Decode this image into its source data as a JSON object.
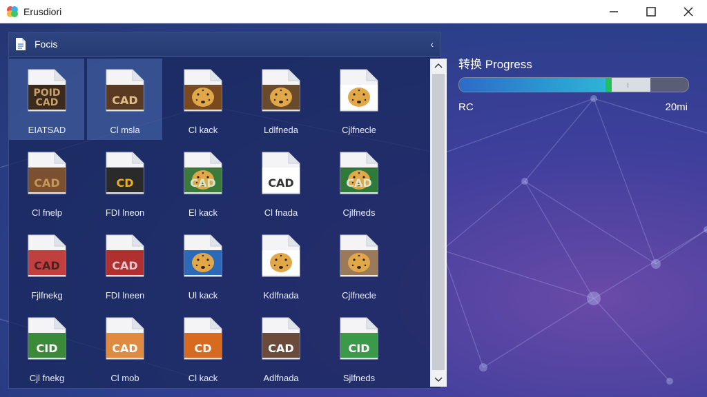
{
  "window": {
    "title": "Erusdiori"
  },
  "panel": {
    "title": "Focis",
    "files": [
      {
        "label": "EIATSAD",
        "icon": "cad-folder-icon",
        "text": "POID\nCAD"
      },
      {
        "label": "Cl msla",
        "icon": "cad-file-icon",
        "text": "CAD"
      },
      {
        "label": "Cl kack",
        "icon": "leopard-file-icon",
        "text": ""
      },
      {
        "label": "Ldlfneda",
        "icon": "leopard-file-icon",
        "text": ""
      },
      {
        "label": "Cjlfnecle",
        "icon": "leopard-file-icon",
        "text": ""
      },
      {
        "label": "Cl fnelp",
        "icon": "cad-file-icon",
        "text": "CAD"
      },
      {
        "label": "FDI lneon",
        "icon": "cad-file-icon",
        "text": "CD"
      },
      {
        "label": "El kack",
        "icon": "cad-leopard-file-icon",
        "text": "CAD"
      },
      {
        "label": "Cl fnada",
        "icon": "cad-file-icon",
        "text": "CAD"
      },
      {
        "label": "Cjlfneds",
        "icon": "cad-leopard-file-icon",
        "text": "CAD"
      },
      {
        "label": "Fjlfnekg",
        "icon": "cad-file-icon",
        "text": "CAD"
      },
      {
        "label": "FDI lneen",
        "icon": "cad-file-icon",
        "text": "CAD"
      },
      {
        "label": "Ul kack",
        "icon": "leopard-file-icon",
        "text": ""
      },
      {
        "label": "Kdlfnada",
        "icon": "leopard-file-icon",
        "text": ""
      },
      {
        "label": "Cjlfnecle",
        "icon": "leopard-file-icon",
        "text": ""
      },
      {
        "label": "Cjl fnekg",
        "icon": "cid-file-icon",
        "text": "CID"
      },
      {
        "label": "Cl mob",
        "icon": "cad-file-icon",
        "text": "CAD"
      },
      {
        "label": "Cl kack",
        "icon": "cad-file-icon",
        "text": "CD"
      },
      {
        "label": "Adlfnada",
        "icon": "cad-file-icon",
        "text": "CAD"
      },
      {
        "label": "Sjlfneds",
        "icon": "cid-file-icon",
        "text": "CID"
      }
    ]
  },
  "progress": {
    "title": "转换 Progress",
    "fill": 0.64,
    "left_label": "RC",
    "right_label": "20mi"
  }
}
